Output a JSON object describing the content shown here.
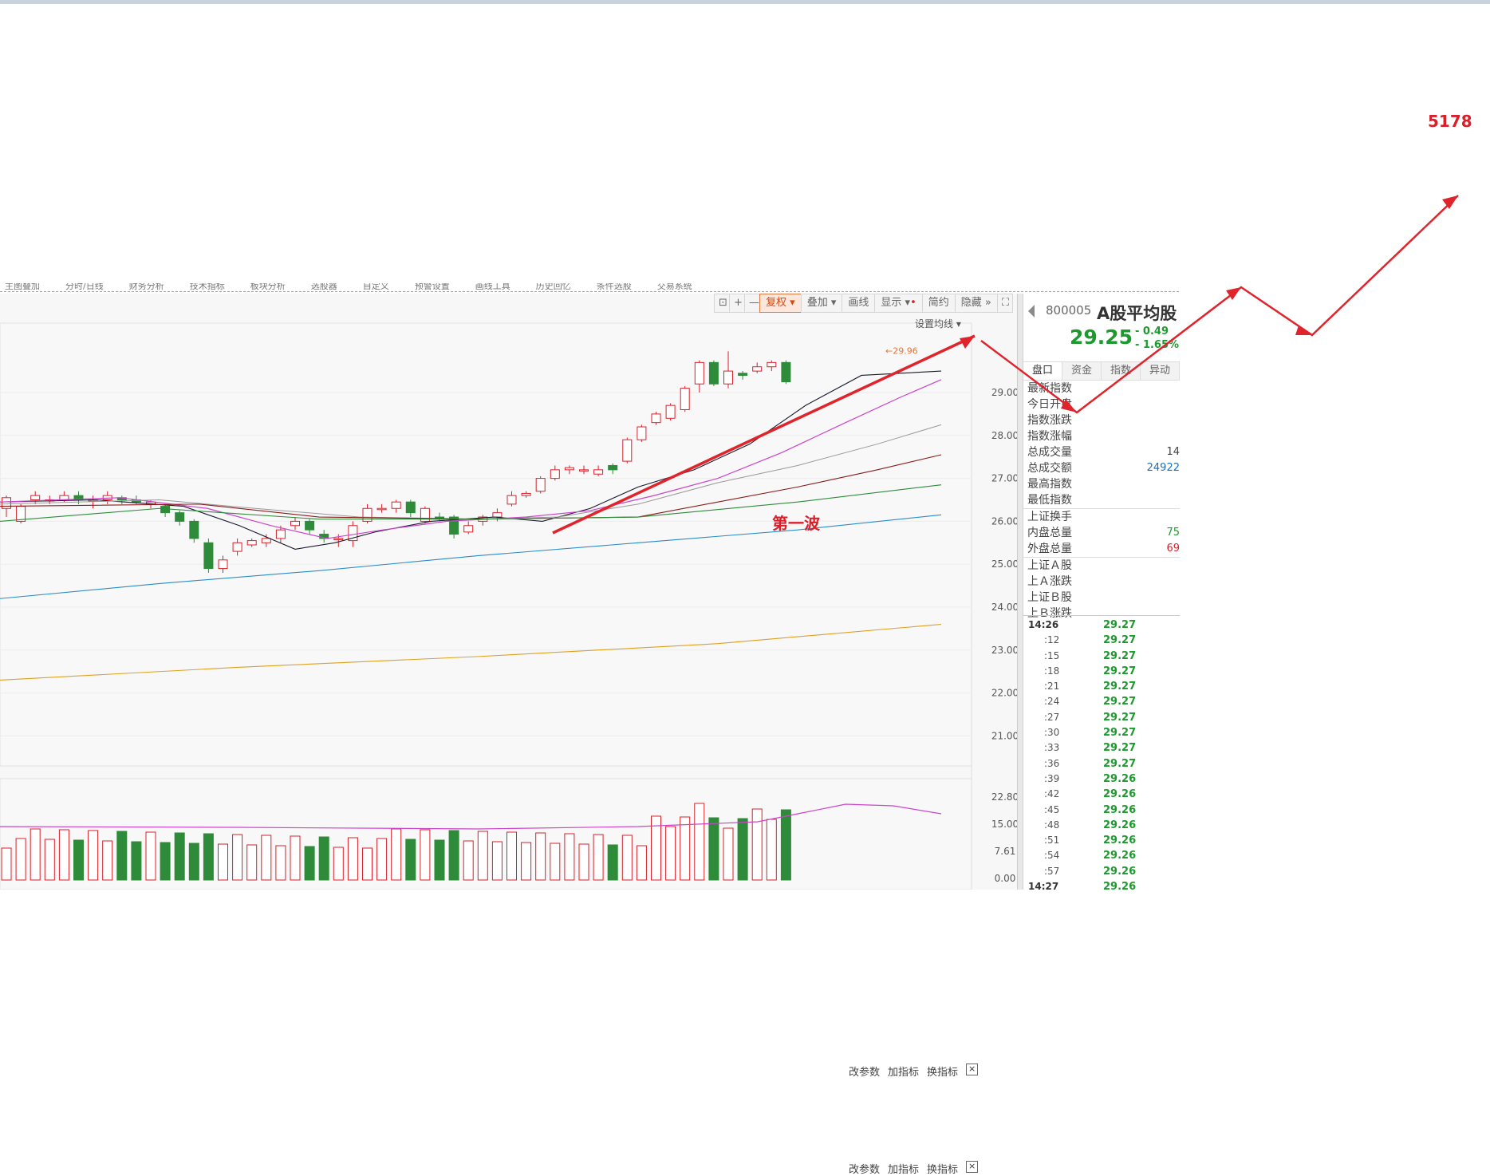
{
  "overlay": {
    "label_5178": "5178",
    "wave_label": "第一波"
  },
  "toolbar": {
    "menu_items": [
      "主图叠加",
      "分时/日线",
      "财务分析",
      "技术指标",
      "板块分析",
      "选股器",
      "自定义",
      "预警设置",
      "画线工具",
      "历史回忆",
      "条件选股",
      "交易系统"
    ],
    "icon_lock": "⊡",
    "icon_plus": "+",
    "icon_minus": "—",
    "fuquan": "复权",
    "diejia": "叠加",
    "huaxian": "画线",
    "xianshi": "显示",
    "jianyue": "简约",
    "yincang": "隐藏",
    "fullscreen": "⛶",
    "set_ma": "设置均线"
  },
  "chart": {
    "max_label": "29.96",
    "price_axis": [
      "29.00",
      "28.00",
      "27.00",
      "26.00",
      "25.00",
      "24.00",
      "23.00",
      "22.00",
      "21.00"
    ],
    "volume_axis": [
      "22.80",
      "15.00",
      "7.61",
      "0.00"
    ],
    "vol_buttons": {
      "gai": "改参数",
      "jia": "加指标",
      "huan": "换指标",
      "close": "×"
    }
  },
  "side": {
    "code": "800005",
    "name": "A股平均股",
    "price": "29.25",
    "change": "- 0.49",
    "change_pct": "- 1.65%",
    "tabs": [
      "盘口",
      "资金",
      "指数",
      "异动"
    ],
    "info": [
      {
        "label": "最新指数",
        "value": ""
      },
      {
        "label": "今日开盘",
        "value": ""
      },
      {
        "label": "指数涨跌",
        "value": ""
      },
      {
        "label": "指数涨幅",
        "value": ""
      },
      {
        "label": "总成交量",
        "value": "14"
      },
      {
        "label": "总成交额",
        "value": "24922"
      },
      {
        "label": "最高指数",
        "value": ""
      },
      {
        "label": "最低指数",
        "value": ""
      },
      {
        "label": "上证换手",
        "value": ""
      },
      {
        "label": "内盘总量",
        "value": "75"
      },
      {
        "label": "外盘总量",
        "value": "69"
      },
      {
        "label": "上证Ａ股",
        "value": ""
      },
      {
        "label": "上Ａ涨跌",
        "value": ""
      },
      {
        "label": "上证Ｂ股",
        "value": ""
      },
      {
        "label": "上Ｂ涨跌",
        "value": ""
      }
    ],
    "ticks": [
      {
        "t": "14:26",
        "p": "29.27"
      },
      {
        "t": ":12",
        "p": "29.27"
      },
      {
        "t": ":15",
        "p": "29.27"
      },
      {
        "t": ":18",
        "p": "29.27"
      },
      {
        "t": ":21",
        "p": "29.27"
      },
      {
        "t": ":24",
        "p": "29.27"
      },
      {
        "t": ":27",
        "p": "29.27"
      },
      {
        "t": ":30",
        "p": "29.27"
      },
      {
        "t": ":33",
        "p": "29.27"
      },
      {
        "t": ":36",
        "p": "29.27"
      },
      {
        "t": ":39",
        "p": "29.26"
      },
      {
        "t": ":42",
        "p": "29.26"
      },
      {
        "t": ":45",
        "p": "29.26"
      },
      {
        "t": ":48",
        "p": "29.26"
      },
      {
        "t": ":51",
        "p": "29.26"
      },
      {
        "t": ":54",
        "p": "29.26"
      },
      {
        "t": ":57",
        "p": "29.26"
      },
      {
        "t": "14:27",
        "p": "29.26"
      }
    ]
  },
  "colors": {
    "up": "#d9202a",
    "down": "#2e8b3a",
    "price_green": "#1d9a2e",
    "accent": "#e07a40"
  }
}
